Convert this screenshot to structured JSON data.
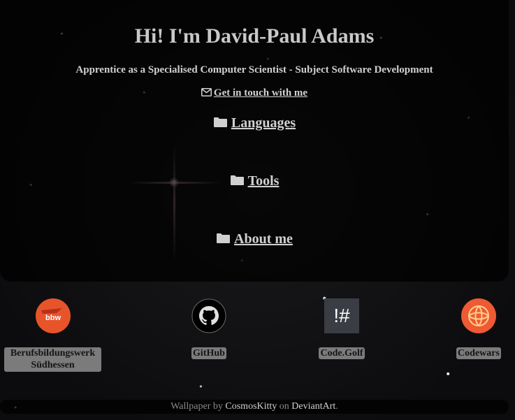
{
  "hero": {
    "title": "Hi! I'm David-Paul Adams",
    "subtitle": "Apprentice as a Specialised Computer Scientist - Subject Software Development",
    "contact_label": "Get in touch with me",
    "contact_icon": "envelope-icon"
  },
  "sections": [
    {
      "label": "Languages",
      "icon": "folder-icon"
    },
    {
      "label": "Tools",
      "icon": "folder-icon"
    },
    {
      "label": "About me",
      "icon": "folder-icon"
    }
  ],
  "links": [
    {
      "label_line1": "Berufsbildungswerk",
      "label_line2": "Südhessen",
      "logo_text": "bbw",
      "logo_color": "#e8542a"
    },
    {
      "label": "GitHub",
      "logo_color": "#000000"
    },
    {
      "label": "Code.Golf",
      "logo_text": "!#",
      "logo_color": "#3a3d44"
    },
    {
      "label": "Codewars",
      "logo_color": "#ee5a34"
    }
  ],
  "footer": {
    "prefix": "Wallpaper by",
    "author": "CosmosKitty",
    "middle": "on",
    "site": "DeviantArt",
    "suffix": "."
  },
  "colors": {
    "text": "#d0d0d0",
    "panel": "#000000",
    "label_bg": "#7b7b7b"
  }
}
